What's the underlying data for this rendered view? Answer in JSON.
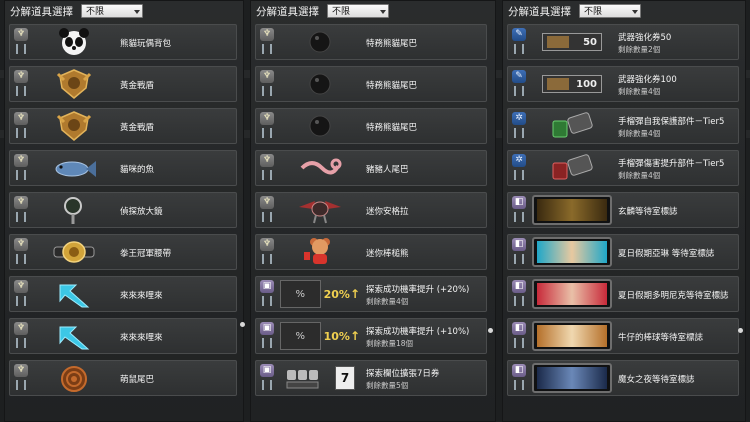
{
  "panels": [
    {
      "title": "分解道具選擇",
      "filter": "不限",
      "items": [
        {
          "name": "熊貓玩偶背包",
          "icon": "panda-backpack-icon"
        },
        {
          "name": "黃金戰盾",
          "icon": "golden-shield-icon"
        },
        {
          "name": "黃金戰盾",
          "icon": "golden-shield-icon"
        },
        {
          "name": "貓咪的魚",
          "icon": "fish-icon"
        },
        {
          "name": "偵探放大鏡",
          "icon": "magnifier-icon"
        },
        {
          "name": "拳王冠軍腰帶",
          "icon": "champion-belt-icon"
        },
        {
          "name": "來來來哩來",
          "icon": "cyan-arrow-icon"
        },
        {
          "name": "來來來哩來",
          "icon": "cyan-arrow-icon"
        },
        {
          "name": "萌鼠尾巴",
          "icon": "curled-tail-icon"
        }
      ]
    },
    {
      "title": "分解道具選擇",
      "filter": "不限",
      "items": [
        {
          "name": "特務熊貓尾巴",
          "icon": "black-ball-tail-icon"
        },
        {
          "name": "特務熊貓尾巴",
          "icon": "black-ball-tail-icon"
        },
        {
          "name": "特務熊貓尾巴",
          "icon": "black-ball-tail-icon"
        },
        {
          "name": "豬豬人尾巴",
          "icon": "pig-tail-icon"
        },
        {
          "name": "迷你安格拉",
          "icon": "mini-dragon-icon"
        },
        {
          "name": "迷你棒槌熊",
          "icon": "mini-bear-icon"
        },
        {
          "name": "探索成功機率提升 (+20%)",
          "sub": "剩餘數量4個",
          "icon": "explore-boost-20-icon",
          "pct": "20%"
        },
        {
          "name": "探索成功機率提升 (+10%)",
          "sub": "剩餘數量18個",
          "icon": "explore-boost-10-icon",
          "pct": "10%"
        },
        {
          "name": "探索欄位擴張7日券",
          "sub": "剩餘數量5個",
          "icon": "slot-expand-7day-icon",
          "days": "7"
        }
      ]
    },
    {
      "title": "分解道具選擇",
      "filter": "不限",
      "items": [
        {
          "name": "武器強化券50",
          "sub": "剩餘數量2個",
          "icon": "weapon-enhance-50-icon",
          "plate": "50"
        },
        {
          "name": "武器強化券100",
          "sub": "剩餘數量4個",
          "icon": "weapon-enhance-100-icon",
          "plate": "100"
        },
        {
          "name": "手榴彈自我保護部件－Tier5",
          "sub": "剩餘數量4個",
          "icon": "grenade-guard-part-icon"
        },
        {
          "name": "手榴彈傷害提升部件－Tier5",
          "sub": "剩餘數量4個",
          "icon": "grenade-damage-part-icon"
        },
        {
          "name": "玄麟等待室標誌",
          "icon": "waiting-room-emblem-icon"
        },
        {
          "name": "夏日假期亞琳 等待室標誌",
          "icon": "waiting-room-emblem-icon"
        },
        {
          "name": "夏日假期多明尼克等待室標誌",
          "icon": "waiting-room-emblem-icon"
        },
        {
          "name": "牛仔的棒球等待室標誌",
          "icon": "waiting-room-emblem-icon"
        },
        {
          "name": "魔女之夜等待室標誌",
          "icon": "waiting-room-emblem-icon"
        }
      ]
    }
  ]
}
